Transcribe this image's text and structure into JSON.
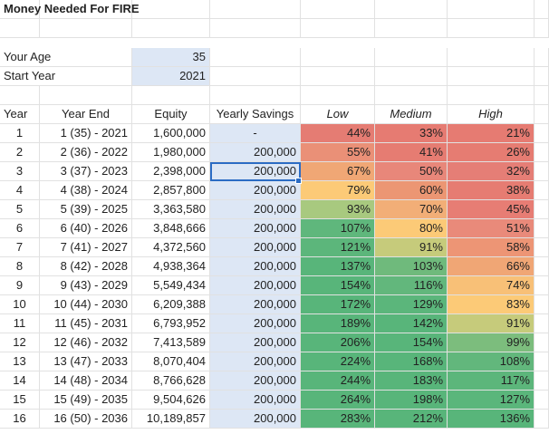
{
  "title": "Money Needed For FIRE",
  "inputs": [
    {
      "label": "Your Age",
      "value": "35"
    },
    {
      "label": "Start Year",
      "value": "2021"
    }
  ],
  "colors": {
    "input_fill": "#dde7f5"
  },
  "headers": [
    "Year",
    "Year End",
    "Equity",
    "Yearly Savings",
    "Low",
    "Medium",
    "High"
  ],
  "rows": [
    {
      "year": "1",
      "end": "1 (35) - 2021",
      "equity": "1,600,000",
      "savings": "-",
      "low": "44%",
      "low_color": "#e57c73",
      "med": "33%",
      "med_color": "#e67b72",
      "high": "21%",
      "high_color": "#e67b72"
    },
    {
      "year": "2",
      "end": "2 (36) - 2022",
      "equity": "1,980,000",
      "savings": "200,000",
      "low": "55%",
      "low_color": "#ea9077",
      "med": "41%",
      "med_color": "#e67c72",
      "high": "26%",
      "high_color": "#e67c72"
    },
    {
      "year": "3",
      "end": "3 (37) - 2023",
      "equity": "2,398,000",
      "savings": "200,000",
      "low": "67%",
      "low_color": "#f0a775",
      "med": "50%",
      "med_color": "#e8877a",
      "high": "32%",
      "high_color": "#e57e76"
    },
    {
      "year": "4",
      "end": "4 (38) - 2024",
      "equity": "2,857,800",
      "savings": "200,000",
      "low": "79%",
      "low_color": "#fcca77",
      "med": "60%",
      "med_color": "#ec9673",
      "high": "38%",
      "high_color": "#e67c72"
    },
    {
      "year": "5",
      "end": "5 (39) - 2025",
      "equity": "3,363,580",
      "savings": "200,000",
      "low": "93%",
      "low_color": "#a8c97f",
      "med": "70%",
      "med_color": "#f2ae77",
      "high": "45%",
      "high_color": "#e77d74"
    },
    {
      "year": "6",
      "end": "6 (40) - 2026",
      "equity": "3,848,666",
      "savings": "200,000",
      "low": "107%",
      "low_color": "#5fb77c",
      "med": "80%",
      "med_color": "#fcca77",
      "high": "51%",
      "high_color": "#e98a7a"
    },
    {
      "year": "7",
      "end": "7 (41) - 2027",
      "equity": "4,372,560",
      "savings": "200,000",
      "low": "121%",
      "low_color": "#5cb67b",
      "med": "91%",
      "med_color": "#c6cb7b",
      "high": "58%",
      "high_color": "#ed9575"
    },
    {
      "year": "8",
      "end": "8 (42) - 2028",
      "equity": "4,938,364",
      "savings": "200,000",
      "low": "137%",
      "low_color": "#58b57a",
      "med": "103%",
      "med_color": "#6fba7c",
      "high": "66%",
      "high_color": "#f0a675"
    },
    {
      "year": "9",
      "end": "9 (43) - 2029",
      "equity": "5,549,434",
      "savings": "200,000",
      "low": "154%",
      "low_color": "#58b57a",
      "med": "116%",
      "med_color": "#62b77c",
      "high": "74%",
      "high_color": "#f8c077"
    },
    {
      "year": "10",
      "end": "10 (44) - 2030",
      "equity": "6,209,388",
      "savings": "200,000",
      "low": "172%",
      "low_color": "#58b57a",
      "med": "129%",
      "med_color": "#5bb67b",
      "high": "83%",
      "high_color": "#fcca77"
    },
    {
      "year": "11",
      "end": "11 (45) - 2031",
      "equity": "6,793,952",
      "savings": "200,000",
      "low": "189%",
      "low_color": "#58b57a",
      "med": "142%",
      "med_color": "#58b57a",
      "high": "91%",
      "high_color": "#c6cb7b"
    },
    {
      "year": "12",
      "end": "12 (46) - 2032",
      "equity": "7,413,589",
      "savings": "200,000",
      "low": "206%",
      "low_color": "#58b57a",
      "med": "154%",
      "med_color": "#58b57a",
      "high": "99%",
      "high_color": "#7cbd7d"
    },
    {
      "year": "13",
      "end": "13 (47) - 2033",
      "equity": "8,070,404",
      "savings": "200,000",
      "low": "224%",
      "low_color": "#58b57a",
      "med": "168%",
      "med_color": "#58b57a",
      "high": "108%",
      "high_color": "#62b77c"
    },
    {
      "year": "14",
      "end": "14 (48) - 2034",
      "equity": "8,766,628",
      "savings": "200,000",
      "low": "244%",
      "low_color": "#58b57a",
      "med": "183%",
      "med_color": "#58b57a",
      "high": "117%",
      "high_color": "#5cb67b"
    },
    {
      "year": "15",
      "end": "15 (49) - 2035",
      "equity": "9,504,626",
      "savings": "200,000",
      "low": "264%",
      "low_color": "#58b57a",
      "med": "198%",
      "med_color": "#58b57a",
      "high": "127%",
      "high_color": "#5ab67b"
    },
    {
      "year": "16",
      "end": "16 (50) - 2036",
      "equity": "10,189,857",
      "savings": "200,000",
      "low": "283%",
      "low_color": "#58b57a",
      "med": "212%",
      "med_color": "#58b57a",
      "high": "136%",
      "high_color": "#58b57a"
    }
  ]
}
